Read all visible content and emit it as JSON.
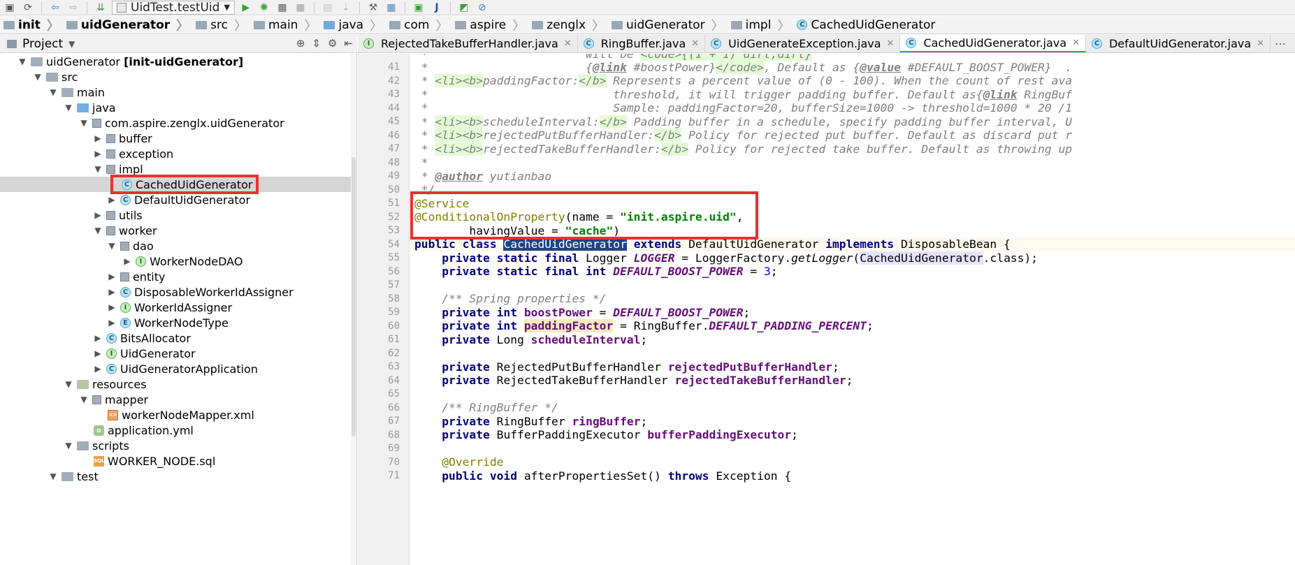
{
  "toolbar": {
    "run_config": "UidTest.testUid"
  },
  "breadcrumb": [
    {
      "label": "init",
      "bold": true
    },
    {
      "label": "uidGenerator",
      "bold": true
    },
    {
      "label": "src"
    },
    {
      "label": "main"
    },
    {
      "label": "java"
    },
    {
      "label": "com"
    },
    {
      "label": "aspire"
    },
    {
      "label": "zenglx"
    },
    {
      "label": "uidGenerator"
    },
    {
      "label": "impl"
    },
    {
      "label": "CachedUidGenerator"
    }
  ],
  "project_panel": {
    "title": "Project"
  },
  "tree": {
    "root_name": "uidGenerator",
    "root_module": "[init-uidGenerator]",
    "src": "src",
    "main": "main",
    "java": "java",
    "package": "com.aspire.zenglx.uidGenerator",
    "buffer": "buffer",
    "exception": "exception",
    "impl": "impl",
    "cached": "CachedUidGenerator",
    "default": "DefaultUidGenerator",
    "utils": "utils",
    "worker": "worker",
    "dao": "dao",
    "worker_node_dao": "WorkerNodeDAO",
    "entity": "entity",
    "disposable": "DisposableWorkerIdAssigner",
    "worker_id_assigner": "WorkerIdAssigner",
    "worker_node_type": "WorkerNodeType",
    "bits_allocator": "BitsAllocator",
    "uid_generator": "UidGenerator",
    "uid_generator_app": "UidGeneratorApplication",
    "resources": "resources",
    "mapper": "mapper",
    "mapper_xml": "workerNodeMapper.xml",
    "application_yml": "application.yml",
    "scripts": "scripts",
    "worker_node_sql": "WORKER_NODE.sql",
    "test": "test"
  },
  "tabs": [
    {
      "label": "RejectedTakeBufferHandler.java",
      "icon": "I"
    },
    {
      "label": "RingBuffer.java",
      "icon": "C"
    },
    {
      "label": "UidGenerateException.java",
      "icon": "C"
    },
    {
      "label": "CachedUidGenerator.java",
      "icon": "C",
      "active": true
    },
    {
      "label": "DefaultUidGenerator.java",
      "icon": "C"
    }
  ],
  "gutter": {
    "lines": [
      "41",
      "42",
      "43",
      "44",
      "45",
      "46",
      "47",
      "48",
      "49",
      "50",
      "51",
      "52",
      "53",
      "54",
      "55",
      "56",
      "57",
      "58",
      "59",
      "60",
      "61",
      "62",
      "63",
      "64",
      "65",
      "66",
      "67",
      "68",
      "69",
      "70",
      "71"
    ]
  },
  "code": {
    "l40a": " *                       will be ",
    "l40b": "<code>{(1 + 1) dirt,dirt}",
    "l41a": " *                       {",
    "l41b": "@link",
    "l41c": " #boostPower}",
    "l41d": "</code>",
    "l41e": ", Default as {",
    "l41f": "@value",
    "l41g": " #DEFAULT_BOOST_POWER}  .",
    "l42a": " * ",
    "l42b": "<li><b>",
    "l42c": "paddingFactor:",
    "l42d": "</b>",
    "l42e": " Represents a percent value of (0 - 100). When the count of rest ava",
    "l43a": " *                           threshold, it will trigger padding buffer. Default as{",
    "l43b": "@link",
    "l43c": " RingBuf",
    "l44": " *                           Sample: paddingFactor=20, bufferSize=1000 -> threshold=1000 * 20 /1",
    "l45a": " * ",
    "l45b": "<li><b>",
    "l45c": "scheduleInterval:",
    "l45d": "</b>",
    "l45e": " Padding buffer in a schedule, specify padding buffer interval, U",
    "l46a": " * ",
    "l46b": "<li><b>",
    "l46c": "rejectedPutBufferHandler:",
    "l46d": "</b>",
    "l46e": " Policy for rejected put buffer. Default as discard put r",
    "l47a": " * ",
    "l47b": "<li><b>",
    "l47c": "rejectedTakeBufferHandler:",
    "l47d": "</b>",
    "l47e": " Policy for rejected take buffer. Default as throwing up",
    "l48": " *",
    "l49a": " * ",
    "l49b": "@author",
    "l49c": " yutianbao",
    "l50": " */",
    "l51": "@Service",
    "l52a": "@ConditionalOnProperty",
    "l52b": "(name = ",
    "l52c": "\"init.aspire.uid\"",
    "l52d": ",",
    "l53a": "        havingValue = ",
    "l53b": "\"cache\"",
    "l53c": ")",
    "l54a": "public class ",
    "l54b": "CachedUidGenerator",
    "l54c": " extends",
    "l54d": " DefaultUidGenerator ",
    "l54e": "implements",
    "l54f": " DisposableBean {",
    "l55a": "    private static final ",
    "l55b": "Logger ",
    "l55c": "LOGGER",
    "l55d": " = LoggerFactory.",
    "l55e": "getLogger",
    "l55f": "(",
    "l55g": "CachedUidGenerator",
    "l55h": ".class);",
    "l56a": "    private static final int ",
    "l56b": "DEFAULT_BOOST_POWER",
    "l56c": " = ",
    "l56d": "3",
    "l56e": ";",
    "l58": "    /** Spring properties */",
    "l59a": "    private int ",
    "l59b": "boostPower",
    "l59c": " = ",
    "l59d": "DEFAULT_BOOST_POWER",
    "l59e": ";",
    "l60a": "    private int ",
    "l60b": "paddingFactor",
    "l60c": " = RingBuffer.",
    "l60d": "DEFAULT_PADDING_PERCENT",
    "l60e": ";",
    "l61a": "    private ",
    "l61b": "Long ",
    "l61c": "scheduleInterval",
    "l61d": ";",
    "l63a": "    private ",
    "l63b": "RejectedPutBufferHandler ",
    "l63c": "rejectedPutBufferHandler",
    "l63d": ";",
    "l64a": "    private ",
    "l64b": "RejectedTakeBufferHandler ",
    "l64c": "rejectedTakeBufferHandler",
    "l64d": ";",
    "l66": "    /** RingBuffer */",
    "l67a": "    private ",
    "l67b": "RingBuffer ",
    "l67c": "ringBuffer",
    "l67d": ";",
    "l68a": "    private ",
    "l68b": "BufferPaddingExecutor ",
    "l68c": "bufferPaddingExecutor",
    "l68d": ";",
    "l70": "    @Override",
    "l71a": "    public void ",
    "l71b": "afterPropertiesSet() ",
    "l71c": "throws",
    "l71d": " Exception {"
  },
  "colors": {
    "highlight_box": "#e63232",
    "selection": "#214283",
    "keyword": "#000080",
    "string": "#008000",
    "annotation": "#808000"
  }
}
